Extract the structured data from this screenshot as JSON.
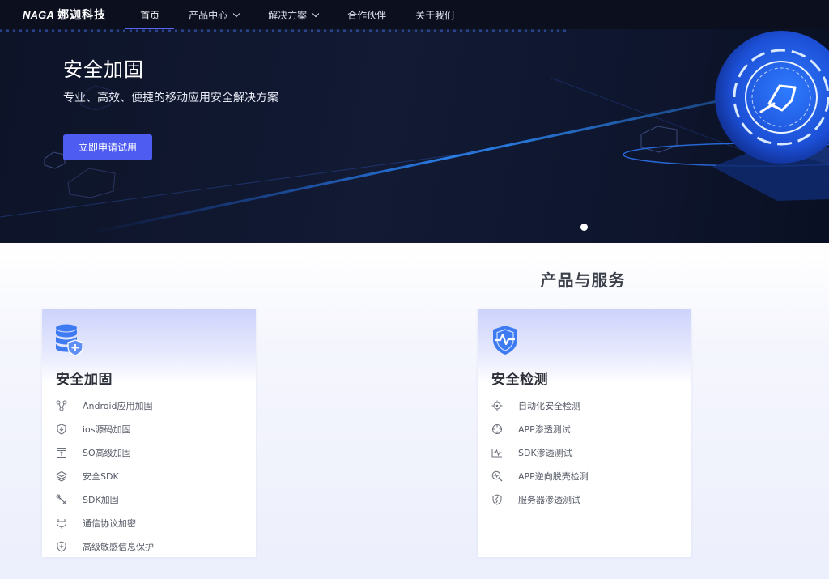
{
  "nav": {
    "logo_en": "NAGA",
    "logo_zh": "娜迦科技",
    "items": [
      {
        "label": "首页",
        "active": true
      },
      {
        "label": "产品中心",
        "dropdown": true
      },
      {
        "label": "解决方案",
        "dropdown": true
      },
      {
        "label": "合作伙伴"
      },
      {
        "label": "关于我们"
      }
    ]
  },
  "hero": {
    "title": "安全加固",
    "subtitle": "专业、高效、便捷的移动应用安全解决方案",
    "button": "立即申请试用"
  },
  "section": {
    "title": "产品与服务",
    "cards": [
      {
        "title": "安全加固",
        "icon": "database-shield-icon",
        "items": [
          {
            "label": "Android应用加固",
            "icon": "nodes-icon"
          },
          {
            "label": "ios源码加固",
            "icon": "shield-down-icon"
          },
          {
            "label": "SO高级加固",
            "icon": "box-up-icon"
          },
          {
            "label": "安全SDK",
            "icon": "layers-icon"
          },
          {
            "label": "SDK加固",
            "icon": "wrench-icon"
          },
          {
            "label": "通信协议加密",
            "icon": "plug-icon"
          },
          {
            "label": "高级敏感信息保护",
            "icon": "shield-plus-icon"
          }
        ]
      },
      {
        "title": "安全检测",
        "icon": "shield-pulse-icon",
        "items": [
          {
            "label": "自动化安全检测",
            "icon": "target-icon"
          },
          {
            "label": "APP渗透测试",
            "icon": "crosshair-icon"
          },
          {
            "label": "SDK渗透测试",
            "icon": "waveform-icon"
          },
          {
            "label": "APP逆向脱壳检测",
            "icon": "search-pulse-icon"
          },
          {
            "label": "服务器渗透测试",
            "icon": "shield-bolt-icon"
          }
        ]
      }
    ]
  },
  "colors": {
    "accent": "#4f5cf2",
    "nav_bg": "#0b0f1e",
    "card_grad_top": "#cdd3fb"
  }
}
